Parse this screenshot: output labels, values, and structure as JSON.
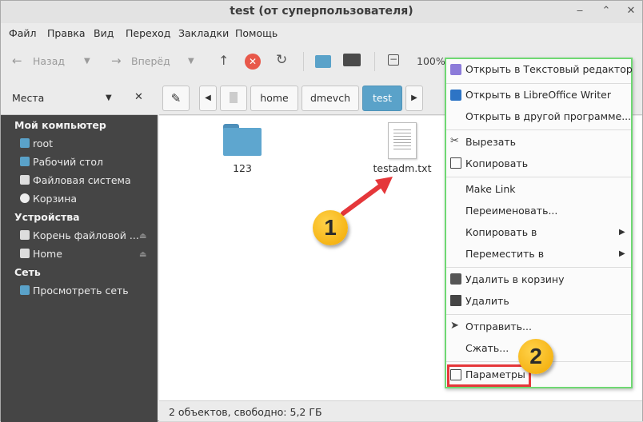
{
  "window": {
    "title": "test (от суперпользователя)"
  },
  "menubar": {
    "items": [
      "Файл",
      "Правка",
      "Вид",
      "Переход",
      "Закладки",
      "Помощь"
    ]
  },
  "toolbar": {
    "back": "Назад",
    "forward": "Вперёд",
    "zoom": "100%"
  },
  "sidebar": {
    "header": "Места",
    "sections": [
      {
        "title": "Мой компьютер",
        "items": [
          "root",
          "Рабочий стол",
          "Файловая система",
          "Корзина"
        ]
      },
      {
        "title": "Устройства",
        "items": [
          "Корень файловой ...",
          "Home"
        ]
      },
      {
        "title": "Сеть",
        "items": [
          "Просмотреть сеть"
        ]
      }
    ]
  },
  "pathbar": {
    "crumbs": [
      "home",
      "dmevch",
      "test"
    ]
  },
  "files": [
    {
      "name": "123",
      "type": "folder"
    },
    {
      "name": "testadm.txt",
      "type": "text-file"
    }
  ],
  "context_menu": {
    "items": [
      "Открыть в Текстовый редактор",
      "Открыть в LibreOffice Writer",
      "Открыть в другой программе...",
      "Вырезать",
      "Копировать",
      "Make Link",
      "Переименовать...",
      "Копировать в",
      "Переместить в",
      "Удалить в корзину",
      "Удалить",
      "Отправить...",
      "Сжать...",
      "Параметры"
    ]
  },
  "status": "2 объектов, свободно: 5,2 ГБ",
  "annotations": [
    "1",
    "2"
  ],
  "colors": {
    "accent": "#5aa2c9",
    "sidebar": "#454545",
    "highlight_box": "#e5373a",
    "menu_border": "#6fd873",
    "badge": "#f5b400"
  }
}
